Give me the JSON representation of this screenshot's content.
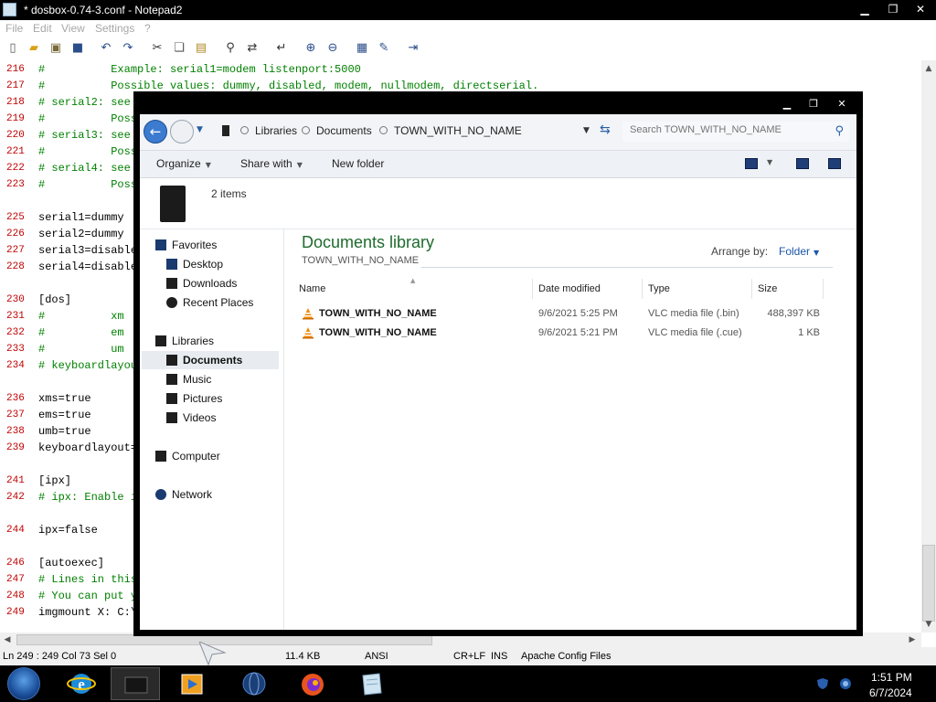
{
  "notepad": {
    "title": "* dosbox-0.74-3.conf - Notepad2",
    "menu": [
      "File",
      "Edit",
      "View",
      "Settings",
      "?"
    ],
    "lines": [
      {
        "num": "216",
        "text": "#          Example: serial1=modem listenport:5000",
        "kind": "comment"
      },
      {
        "num": "217",
        "text": "#          Possible values: dummy, disabled, modem, nullmodem, directserial.",
        "kind": "comment"
      },
      {
        "num": "218",
        "text": "# serial2: see",
        "kind": "comment"
      },
      {
        "num": "219",
        "text": "#          Poss",
        "kind": "comment"
      },
      {
        "num": "220",
        "text": "# serial3: see",
        "kind": "comment"
      },
      {
        "num": "221",
        "text": "#          Poss",
        "kind": "comment"
      },
      {
        "num": "222",
        "text": "# serial4: see",
        "kind": "comment"
      },
      {
        "num": "223",
        "text": "#          Poss",
        "kind": "comment"
      },
      {
        "num": "",
        "text": "",
        "kind": "code"
      },
      {
        "num": "225",
        "text": "serial1=dummy",
        "kind": "code"
      },
      {
        "num": "226",
        "text": "serial2=dummy",
        "kind": "code"
      },
      {
        "num": "227",
        "text": "serial3=disable",
        "kind": "code"
      },
      {
        "num": "228",
        "text": "serial4=disable",
        "kind": "code"
      },
      {
        "num": "",
        "text": "",
        "kind": "code"
      },
      {
        "num": "230",
        "text": "[dos]",
        "kind": "code"
      },
      {
        "num": "231",
        "text": "#          xm",
        "kind": "comment"
      },
      {
        "num": "232",
        "text": "#          em",
        "kind": "comment"
      },
      {
        "num": "233",
        "text": "#          um",
        "kind": "comment"
      },
      {
        "num": "234",
        "text": "# keyboardlayou",
        "kind": "comment"
      },
      {
        "num": "",
        "text": "",
        "kind": "code"
      },
      {
        "num": "236",
        "text": "xms=true",
        "kind": "code"
      },
      {
        "num": "237",
        "text": "ems=true",
        "kind": "code"
      },
      {
        "num": "238",
        "text": "umb=true",
        "kind": "code"
      },
      {
        "num": "239",
        "text": "keyboardlayout=",
        "kind": "code"
      },
      {
        "num": "",
        "text": "",
        "kind": "code"
      },
      {
        "num": "241",
        "text": "[ipx]",
        "kind": "code"
      },
      {
        "num": "242",
        "text": "# ipx: Enable i",
        "kind": "comment"
      },
      {
        "num": "",
        "text": "",
        "kind": "code"
      },
      {
        "num": "244",
        "text": "ipx=false",
        "kind": "code"
      },
      {
        "num": "",
        "text": "",
        "kind": "code"
      },
      {
        "num": "246",
        "text": "[autoexec]",
        "kind": "code"
      },
      {
        "num": "247",
        "text": "# Lines in this",
        "kind": "comment"
      },
      {
        "num": "248",
        "text": "# You can put y",
        "kind": "comment"
      },
      {
        "num": "249",
        "text": "imgmount X: C:\\",
        "kind": "code"
      }
    ],
    "status": {
      "position": "Ln 249 : 249   Col 73   Sel 0",
      "size": "11.4 KB",
      "encoding": "ANSI",
      "eol": "CR+LF",
      "mode": "INS",
      "scheme": "Apache Config Files"
    }
  },
  "explorer": {
    "breadcrumb": [
      "Libraries",
      "Documents",
      "TOWN_WITH_NO_NAME"
    ],
    "search_placeholder": "Search TOWN_WITH_NO_NAME",
    "commands": {
      "organize": "Organize",
      "share": "Share with",
      "new_folder": "New folder"
    },
    "items_count": "2 items",
    "nav": {
      "favorites": "Favorites",
      "desktop": "Desktop",
      "downloads": "Downloads",
      "recent": "Recent Places",
      "libraries": "Libraries",
      "documents": "Documents",
      "music": "Music",
      "pictures": "Pictures",
      "videos": "Videos",
      "computer": "Computer",
      "network": "Network"
    },
    "library_title": "Documents library",
    "library_subtitle": "TOWN_WITH_NO_NAME",
    "arrange_label": "Arrange by:",
    "arrange_value": "Folder",
    "columns": {
      "name": "Name",
      "date": "Date modified",
      "type": "Type",
      "size": "Size"
    },
    "files": [
      {
        "name": "TOWN_WITH_NO_NAME",
        "date": "9/6/2021 5:25 PM",
        "type": "VLC media file (.bin)",
        "size": "488,397 KB"
      },
      {
        "name": "TOWN_WITH_NO_NAME",
        "date": "9/6/2021 5:21 PM",
        "type": "VLC media file (.cue)",
        "size": "1 KB"
      }
    ]
  },
  "taskbar": {
    "time": "1:51 PM",
    "date": "6/7/2024"
  },
  "icons": {
    "back": "back-arrow-icon",
    "forward": "forward-arrow-icon",
    "refresh": "refresh-icon",
    "search": "search-icon",
    "vlc": "vlc-cone-icon"
  },
  "colors": {
    "line_number": "#c00000",
    "comment": "#008000",
    "library_title": "#1e6b2d",
    "link": "#1a55a8"
  }
}
